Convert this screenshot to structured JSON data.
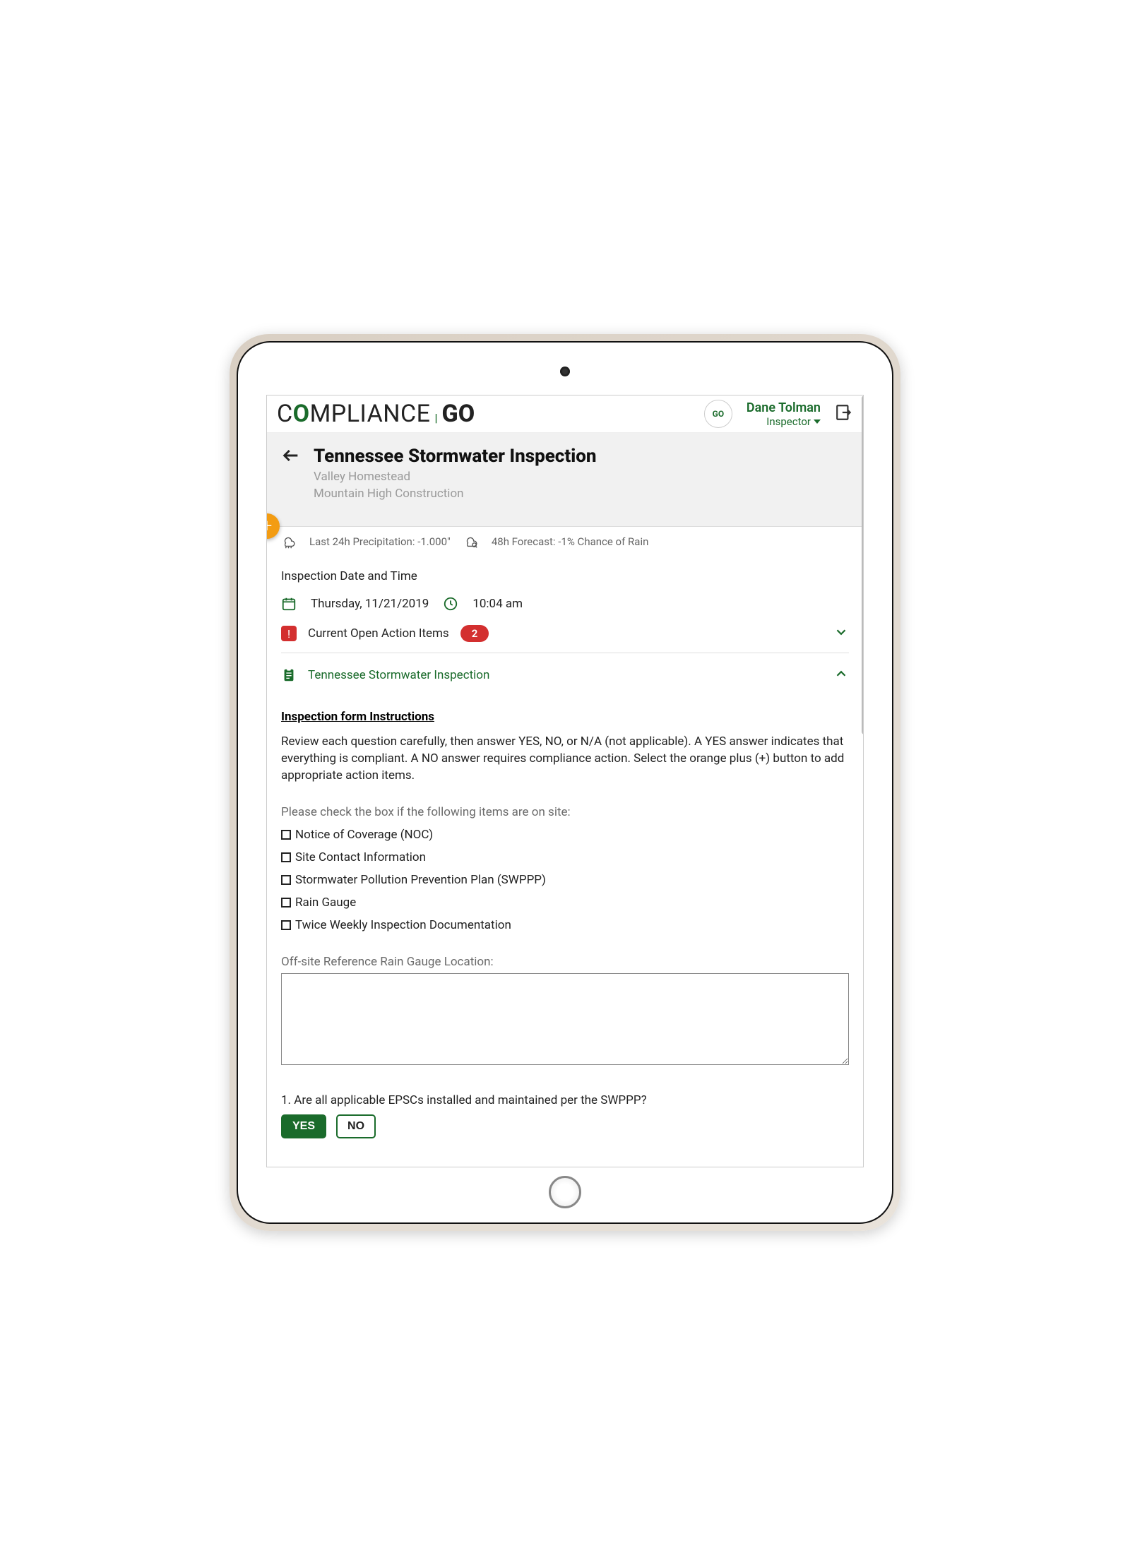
{
  "appbar": {
    "logo_compliance": "COMPLIANCE",
    "logo_go": "GO",
    "user_name": "Dane Tolman",
    "user_role": "Inspector"
  },
  "header": {
    "title": "Tennessee Stormwater Inspection",
    "site": "Valley Homestead",
    "company": "Mountain High Construction"
  },
  "weather": {
    "precip_label": "Last 24h Precipitation: -1.000\"",
    "forecast_label": "48h Forecast: -1% Chance of Rain"
  },
  "datetime": {
    "section_label": "Inspection Date and Time",
    "date": "Thursday, 11/21/2019",
    "time": "10:04 am"
  },
  "action_items": {
    "title": "Current Open Action Items",
    "count": "2"
  },
  "form_section": {
    "title": "Tennessee Stormwater Inspection",
    "instructions_heading": "Inspection form Instructions",
    "instructions_body": "Review each question carefully, then answer YES, NO, or N/A (not applicable). A YES answer indicates that everything is compliant. A NO answer requires compliance action. Select the orange plus (+) button to add appropriate action items.",
    "checklist_label": "Please check the box if the following items are on site:",
    "checklist": [
      "Notice of Coverage (NOC)",
      "Site Contact Information",
      "Stormwater Pollution Prevention Plan (SWPPP)",
      "Rain Gauge",
      "Twice Weekly Inspection Documentation"
    ],
    "rain_gauge_label": "Off-site Reference Rain Gauge Location:",
    "rain_gauge_value": "",
    "question1": "1. Are all applicable EPSCs installed and maintained per the SWPPP?",
    "yes": "YES",
    "no": "NO"
  }
}
